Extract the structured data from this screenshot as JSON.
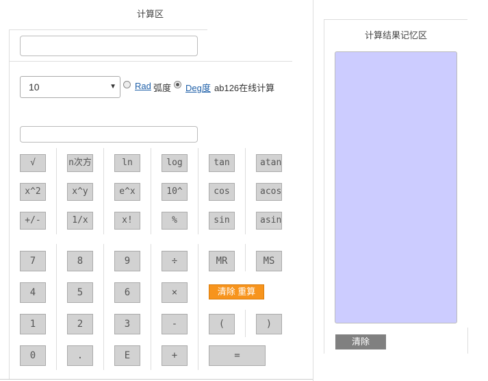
{
  "calc_area": {
    "title": "计算区",
    "expression_value": "",
    "base_value": "10",
    "rad_label": "Rad",
    "rad_text": "弧度",
    "deg_label": "Deg度",
    "site_text": "ab126在线计算",
    "angle_mode": "Deg",
    "result_value": ""
  },
  "keys": {
    "sqrt": "√",
    "nth_root": "n次方",
    "ln": "ln",
    "log": "log",
    "tan": "tan",
    "atan": "atan",
    "square": "x^2",
    "power": "x^y",
    "exp": "e^x",
    "ten_pow": "10^",
    "cos": "cos",
    "acos": "acos",
    "negate": "+/-",
    "reciprocal": "1/x",
    "factorial": "x!",
    "percent": "%",
    "sin": "sin",
    "asin": "asin",
    "d7": "7",
    "d8": "8",
    "d9": "9",
    "divide": "÷",
    "mr": "MR",
    "ms": "MS",
    "d4": "4",
    "d5": "5",
    "d6": "6",
    "multiply": "×",
    "clear_reset": "清除 重算",
    "d1": "1",
    "d2": "2",
    "d3": "3",
    "minus": "-",
    "lparen": "(",
    "rparen": ")",
    "d0": "0",
    "dot": ".",
    "e": "E",
    "plus": "+",
    "equals": "="
  },
  "memory_area": {
    "title": "计算结果记忆区",
    "clear_label": "清除"
  },
  "colors": {
    "memory_bg": "#ccccff",
    "clear_reset_bg": "#f7941d",
    "key_bg": "#d2d2d2"
  }
}
